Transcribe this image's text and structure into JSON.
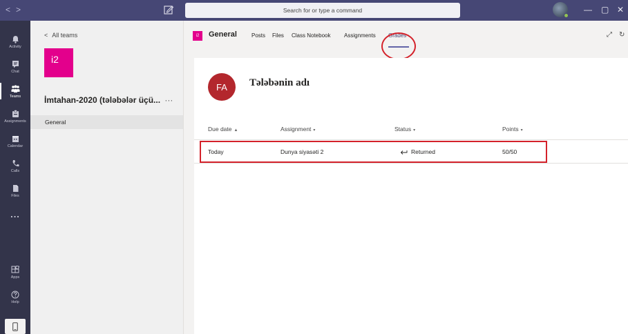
{
  "titlebar": {
    "search_placeholder": "Search for or type a command",
    "nav_back": "<",
    "nav_forward": ">",
    "minimize": "—",
    "maximize": "▢",
    "close": "✕"
  },
  "appbar": {
    "items": [
      {
        "label": "Activity",
        "icon": "bell-icon"
      },
      {
        "label": "Chat",
        "icon": "chat-icon"
      },
      {
        "label": "Teams",
        "icon": "teams-icon",
        "active": true
      },
      {
        "label": "Assignments",
        "icon": "assignments-icon"
      },
      {
        "label": "Calendar",
        "icon": "calendar-icon"
      },
      {
        "label": "Calls",
        "icon": "phone-icon"
      },
      {
        "label": "Files",
        "icon": "files-icon"
      },
      {
        "label": "...",
        "icon": "more-icon"
      },
      {
        "label": "Apps",
        "icon": "apps-icon"
      },
      {
        "label": "Help",
        "icon": "help-icon"
      }
    ]
  },
  "teampanel": {
    "back_label": "All teams",
    "team_initials": "i2",
    "team_name": "İmtahan-2020 (tələbələr üçü...",
    "team_more": "···",
    "channel": "General"
  },
  "header": {
    "channel_initials": "i2",
    "channel_name": "General",
    "tabs": [
      {
        "label": "Posts"
      },
      {
        "label": "Files"
      },
      {
        "label": "Class Notebook"
      },
      {
        "label": "Assignments"
      },
      {
        "label": "Grades",
        "active": true
      }
    ],
    "expand_icon": "⤢",
    "refresh_icon": "↻"
  },
  "grades": {
    "student_initials": "FA",
    "student_name": "Tələbənin adı",
    "columns": {
      "due_date": "Due date",
      "due_date_sort": "▲",
      "assignment": "Assignment",
      "assignment_sort": "▾",
      "status": "Status",
      "status_sort": "▾",
      "points": "Points",
      "points_sort": "▾"
    },
    "rows": [
      {
        "due_date": "Today",
        "assignment": "Dunya siyasəti 2",
        "status": "Returned",
        "points": "50/50"
      }
    ]
  },
  "colors": {
    "titlebar": "#464775",
    "appbar": "#33344a",
    "team_tile": "#e3008c",
    "student_avatar": "#b3272d",
    "annotation_red": "#d4212a",
    "accent": "#6264a7"
  }
}
